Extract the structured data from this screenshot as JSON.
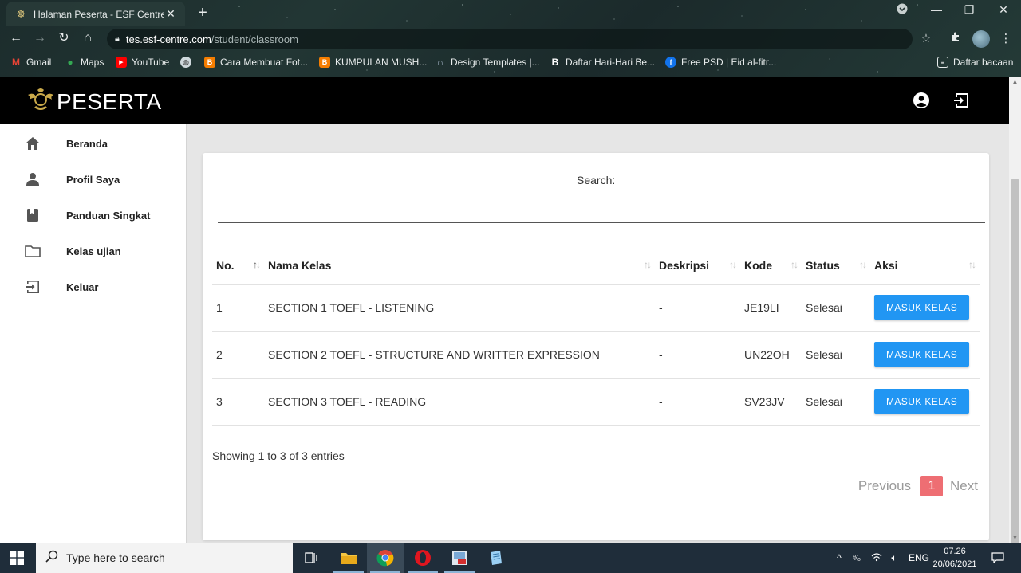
{
  "browser": {
    "tab_title": "Halaman Peserta - ESF Centre | A",
    "url_host": "tes.esf-centre.com",
    "url_path": "/student/classroom",
    "bookmarks": [
      {
        "label": "Gmail",
        "icon": "gmail-icon",
        "color": "#ea4335"
      },
      {
        "label": "Maps",
        "icon": "maps-icon",
        "color": "#34a853"
      },
      {
        "label": "YouTube",
        "icon": "youtube-icon",
        "color": "#ff0000"
      },
      {
        "label": "",
        "icon": "globe-icon",
        "color": "#cfd8dc"
      },
      {
        "label": "Cara Membuat Fot...",
        "icon": "blogger-icon",
        "color": "#f57d00"
      },
      {
        "label": "KUMPULAN MUSH...",
        "icon": "blogger-icon",
        "color": "#f57d00"
      },
      {
        "label": "Design Templates |...",
        "icon": "canva-icon",
        "color": "#9ab"
      },
      {
        "label": "Daftar Hari-Hari Be...",
        "icon": "b-icon",
        "color": "#ffffff"
      },
      {
        "label": "Free PSD | Eid al-fitr...",
        "icon": "freepik-icon",
        "color": "#1273eb"
      }
    ],
    "reading_list": "Daftar bacaan"
  },
  "app": {
    "brand": "PESERTA"
  },
  "sidebar": {
    "items": [
      {
        "label": "Beranda",
        "icon": "home-icon"
      },
      {
        "label": "Profil Saya",
        "icon": "person-icon"
      },
      {
        "label": "Panduan Singkat",
        "icon": "book-icon"
      },
      {
        "label": "Kelas ujian",
        "icon": "folder-icon"
      },
      {
        "label": "Keluar",
        "icon": "logout-icon"
      }
    ]
  },
  "table": {
    "search_label": "Search:",
    "search_value": "",
    "columns": [
      "No.",
      "Nama Kelas",
      "Deskripsi",
      "Kode",
      "Status",
      "Aksi"
    ],
    "rows": [
      {
        "no": "1",
        "nama": "SECTION 1 TOEFL - LISTENING",
        "deskripsi": "-",
        "kode": "JE19LI",
        "status": "Selesai",
        "aksi": "MASUK KELAS"
      },
      {
        "no": "2",
        "nama": "SECTION 2 TOEFL - STRUCTURE AND WRITTER EXPRESSION",
        "deskripsi": "-",
        "kode": "UN22OH",
        "status": "Selesai",
        "aksi": "MASUK KELAS"
      },
      {
        "no": "3",
        "nama": "SECTION 3 TOEFL - READING",
        "deskripsi": "-",
        "kode": "SV23JV",
        "status": "Selesai",
        "aksi": "MASUK KELAS"
      }
    ],
    "info": "Showing 1 to 3 of 3 entries",
    "pagination": {
      "previous": "Previous",
      "current": "1",
      "next": "Next"
    }
  },
  "taskbar": {
    "search_placeholder": "Type here to search",
    "language": "ENG",
    "time": "07.26",
    "date": "20/06/2021"
  },
  "colors": {
    "appbar": "#000000",
    "button": "#2196f3",
    "page_active": "#ee6e73"
  }
}
